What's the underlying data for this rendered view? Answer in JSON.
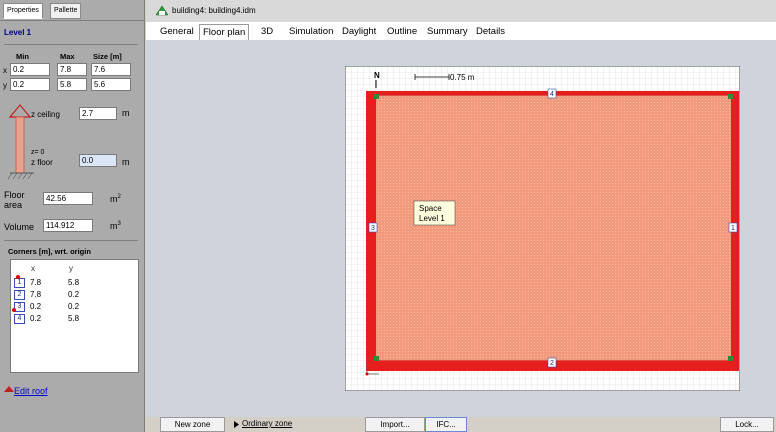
{
  "left_panel": {
    "tabs": [
      "Properties",
      "Pallette"
    ],
    "level_title": "Level 1",
    "dims": {
      "headers": [
        "Min",
        "Max",
        "Size [m]"
      ],
      "rows": [
        {
          "axis": "x",
          "min": "0.2",
          "max": "7.8",
          "size": "7.6"
        },
        {
          "axis": "y",
          "min": "0.2",
          "max": "5.8",
          "size": "5.6"
        }
      ]
    },
    "ceiling": {
      "label": "z ceiling",
      "value": "2.7",
      "unit": "m"
    },
    "floor": {
      "z0_label": "z= 0",
      "label": "z floor",
      "value": "0.0",
      "unit": "m"
    },
    "floor_area": {
      "label_line1": "Floor",
      "label_line2": "area",
      "value": "42.56",
      "unit": "m",
      "unit_exp": "2"
    },
    "volume": {
      "label": "Volume",
      "value": "114.912",
      "unit": "m",
      "unit_exp": "3"
    },
    "corners": {
      "title": "Corners [m], wrt. origin",
      "col_x": "x",
      "col_y": "y",
      "rows": [
        {
          "n": "1",
          "x": "7.8",
          "y": "5.8"
        },
        {
          "n": "2",
          "x": "7.8",
          "y": "0.2"
        },
        {
          "n": "3",
          "x": "0.2",
          "y": "0.2"
        },
        {
          "n": "4",
          "x": "0.2",
          "y": "5.8"
        }
      ]
    },
    "edit_roof": "Edit roof"
  },
  "window": {
    "title": "building4: building4.idm",
    "tabs": [
      "General",
      "Floor plan",
      "3D",
      "Simulation",
      "Daylight",
      "Outline",
      "Summary",
      "Details"
    ],
    "active_tab": "Floor plan"
  },
  "plan": {
    "north": "N",
    "scale": "0.75 m",
    "space_label_line1": "Space",
    "space_label_line2": "Level 1",
    "wall_labels": [
      "4",
      "1",
      "2",
      "3"
    ],
    "colors": {
      "wall": "#e61e1e",
      "floor": "#f39a7c",
      "grid": "#d2d2d2"
    }
  },
  "bottom": {
    "new_zone": "New zone",
    "zone_type": "Ordinary zone",
    "import": "Import...",
    "ifc": "IFC...",
    "lock": "Lock..."
  }
}
